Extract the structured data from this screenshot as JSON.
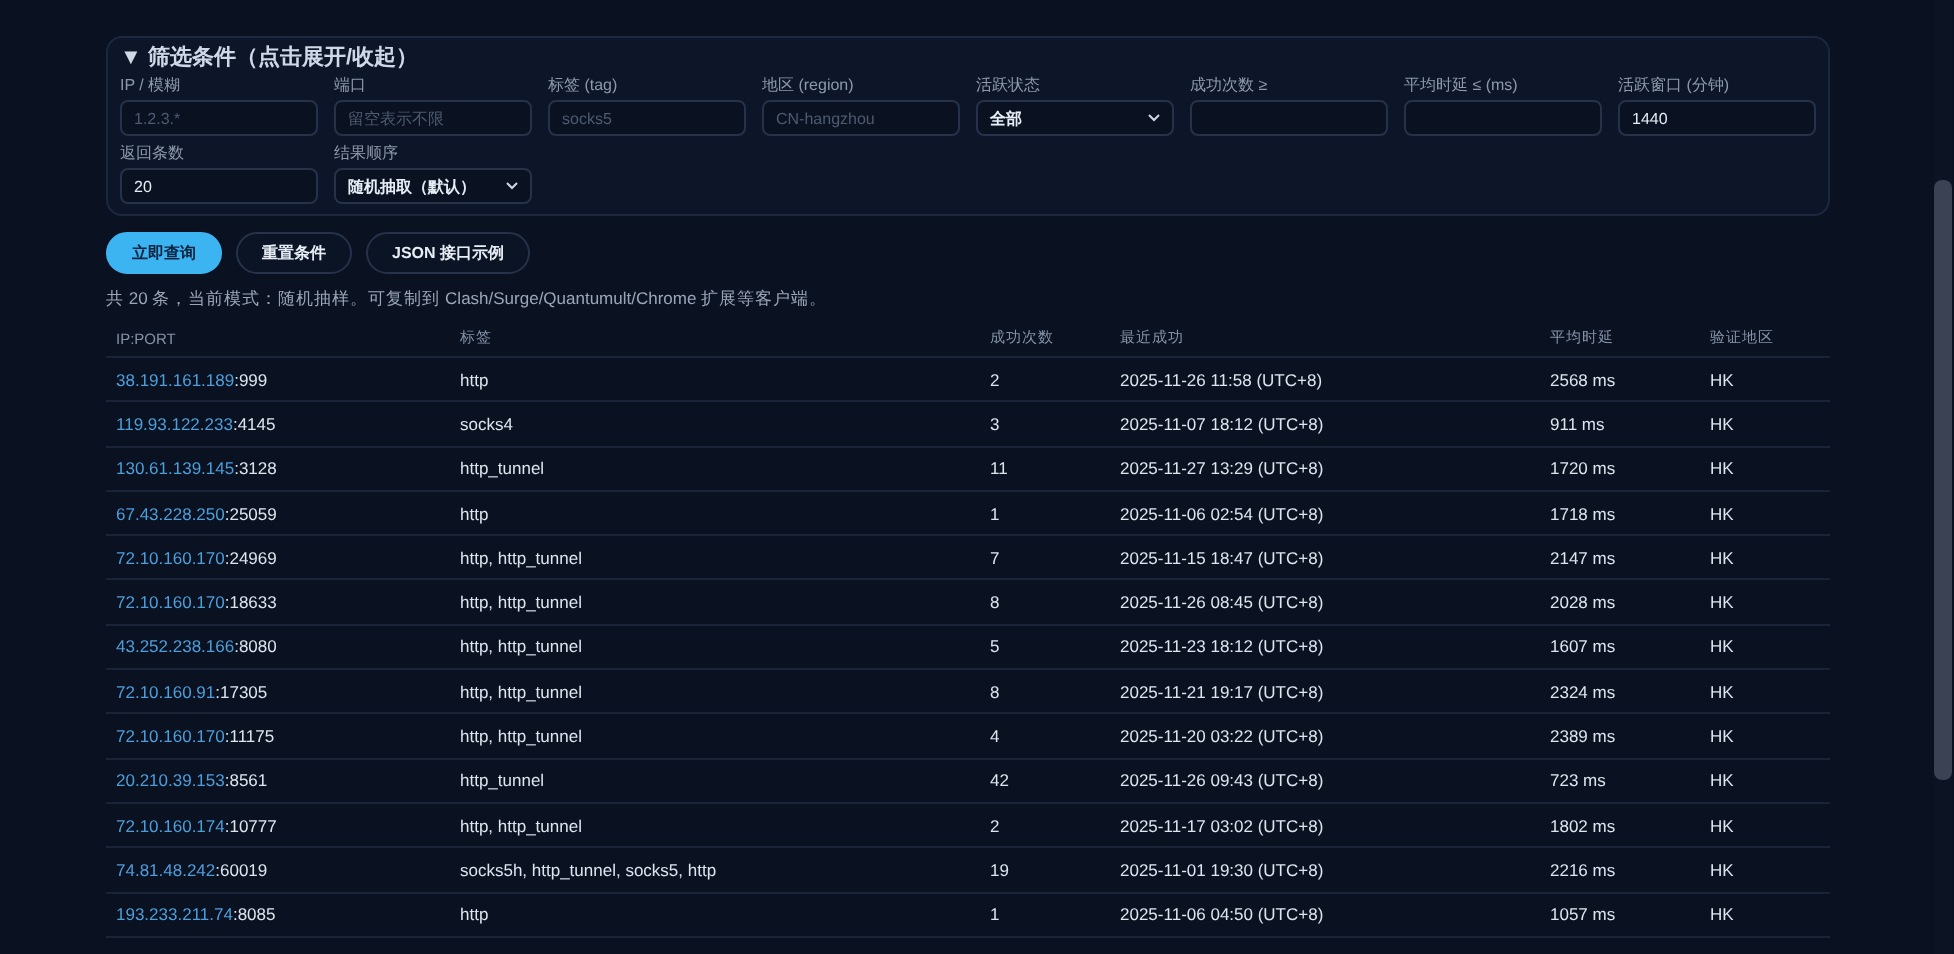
{
  "filter": {
    "title": "▼ 筛选条件（点击展开/收起）",
    "fields": [
      {
        "kind": "input",
        "label": "IP / 模糊",
        "placeholder": "1.2.3.*"
      },
      {
        "kind": "input",
        "label": "端口",
        "placeholder": "留空表示不限"
      },
      {
        "kind": "input",
        "label": "标签 (tag)",
        "placeholder": "socks5"
      },
      {
        "kind": "input",
        "label": "地区 (region)",
        "placeholder": "CN-hangzhou"
      },
      {
        "kind": "select",
        "label": "活跃状态",
        "value": "全部"
      },
      {
        "kind": "input",
        "label": "成功次数 ≥"
      },
      {
        "kind": "input",
        "label": "平均时延 ≤ (ms)"
      },
      {
        "kind": "input",
        "label": "活跃窗口 (分钟)",
        "value": "1440"
      },
      {
        "kind": "input",
        "label": "返回条数",
        "value": "20"
      },
      {
        "kind": "select",
        "label": "结果顺序",
        "value": "随机抽取（默认）"
      }
    ]
  },
  "buttons": [
    {
      "label": "立即查询",
      "kind": "primary"
    },
    {
      "label": "重置条件",
      "kind": "outline"
    },
    {
      "label": "JSON 接口示例",
      "kind": "outline"
    }
  ],
  "summary": "共 20 条，当前模式：随机抽样。可复制到 Clash/Surge/Quantumult/Chrome 扩展等客户端。",
  "table": {
    "columns": [
      "IP:PORT",
      "标签",
      "成功次数",
      "最近成功",
      "平均时延",
      "验证地区"
    ],
    "rows": [
      {
        "ip": "38.191.161.189",
        "port": ":999",
        "tags": "http",
        "success": "2",
        "last": "2025-11-26 11:58 (UTC+8)",
        "latency": "2568 ms",
        "region": "HK"
      },
      {
        "ip": "119.93.122.233",
        "port": ":4145",
        "tags": "socks4",
        "success": "3",
        "last": "2025-11-07 18:12 (UTC+8)",
        "latency": "911 ms",
        "region": "HK"
      },
      {
        "ip": "130.61.139.145",
        "port": ":3128",
        "tags": "http_tunnel",
        "success": "11",
        "last": "2025-11-27 13:29 (UTC+8)",
        "latency": "1720 ms",
        "region": "HK"
      },
      {
        "ip": "67.43.228.250",
        "port": ":25059",
        "tags": "http",
        "success": "1",
        "last": "2025-11-06 02:54 (UTC+8)",
        "latency": "1718 ms",
        "region": "HK"
      },
      {
        "ip": "72.10.160.170",
        "port": ":24969",
        "tags": "http, http_tunnel",
        "success": "7",
        "last": "2025-11-15 18:47 (UTC+8)",
        "latency": "2147 ms",
        "region": "HK"
      },
      {
        "ip": "72.10.160.170",
        "port": ":18633",
        "tags": "http, http_tunnel",
        "success": "8",
        "last": "2025-11-26 08:45 (UTC+8)",
        "latency": "2028 ms",
        "region": "HK"
      },
      {
        "ip": "43.252.238.166",
        "port": ":8080",
        "tags": "http, http_tunnel",
        "success": "5",
        "last": "2025-11-23 18:12 (UTC+8)",
        "latency": "1607 ms",
        "region": "HK"
      },
      {
        "ip": "72.10.160.91",
        "port": ":17305",
        "tags": "http, http_tunnel",
        "success": "8",
        "last": "2025-11-21 19:17 (UTC+8)",
        "latency": "2324 ms",
        "region": "HK"
      },
      {
        "ip": "72.10.160.170",
        "port": ":11175",
        "tags": "http, http_tunnel",
        "success": "4",
        "last": "2025-11-20 03:22 (UTC+8)",
        "latency": "2389 ms",
        "region": "HK"
      },
      {
        "ip": "20.210.39.153",
        "port": ":8561",
        "tags": "http_tunnel",
        "success": "42",
        "last": "2025-11-26 09:43 (UTC+8)",
        "latency": "723 ms",
        "region": "HK"
      },
      {
        "ip": "72.10.160.174",
        "port": ":10777",
        "tags": "http, http_tunnel",
        "success": "2",
        "last": "2025-11-17 03:02 (UTC+8)",
        "latency": "1802 ms",
        "region": "HK"
      },
      {
        "ip": "74.81.48.242",
        "port": ":60019",
        "tags": "socks5h, http_tunnel, socks5, http",
        "success": "19",
        "last": "2025-11-01 19:30 (UTC+8)",
        "latency": "2216 ms",
        "region": "HK"
      },
      {
        "ip": "193.233.211.74",
        "port": ":8085",
        "tags": "http",
        "success": "1",
        "last": "2025-11-06 04:50 (UTC+8)",
        "latency": "1057 ms",
        "region": "HK"
      }
    ]
  }
}
